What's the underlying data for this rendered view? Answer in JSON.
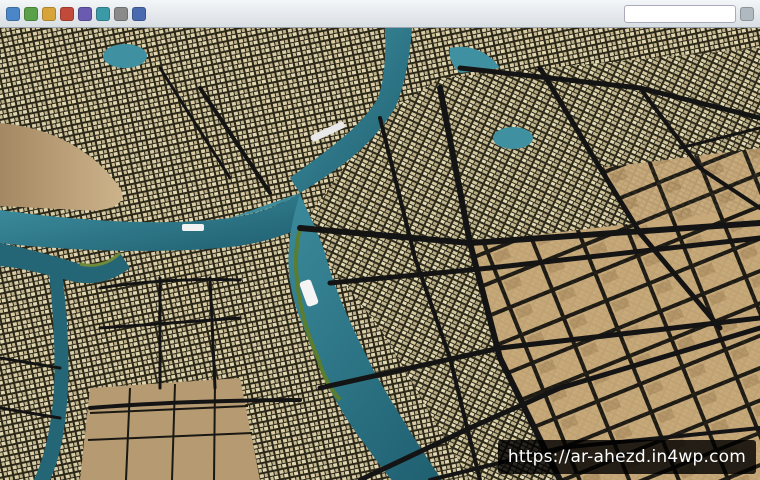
{
  "watermark": {
    "url": "https://ar-ahezd.in4wp.com"
  },
  "colors": {
    "river": "#2a7083",
    "river_highlight": "#3f91a2",
    "city_blocks": "#c9bd97",
    "roads": "#151515",
    "sand": "#c4a67a",
    "toolbar": "#e6eaee",
    "watermark_bg": "#111111"
  },
  "toolbar": {
    "icons": [
      "back-icon",
      "forward-icon",
      "reload-icon",
      "home-icon",
      "bookmark-icon",
      "settings-icon",
      "tools-icon",
      "share-icon"
    ]
  }
}
